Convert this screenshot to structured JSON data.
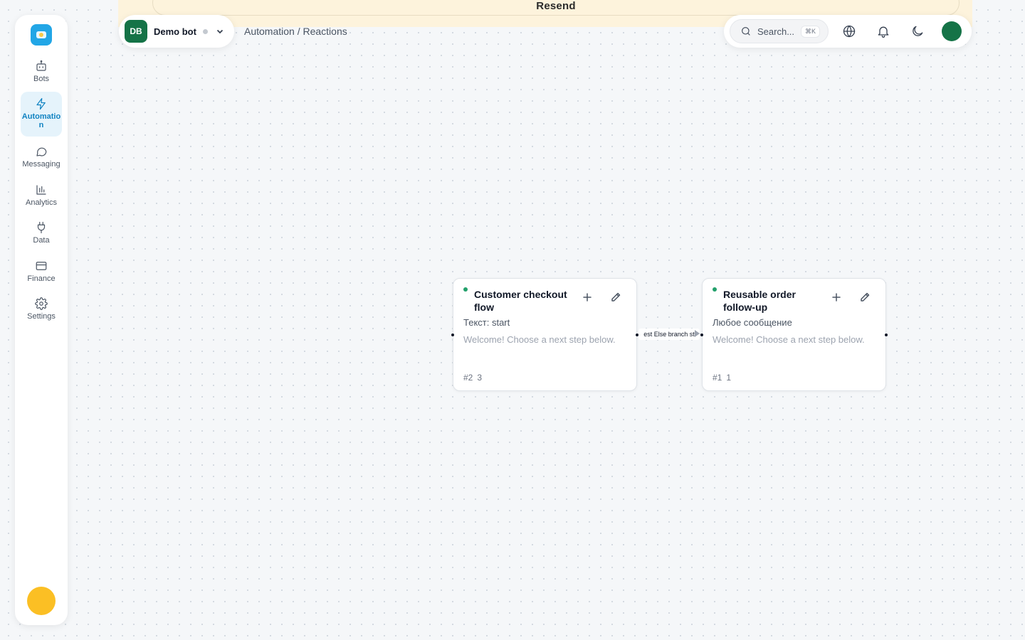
{
  "banner": {
    "text": "Resend"
  },
  "sidebar": {
    "items": [
      {
        "label": "Bots",
        "icon": "bot-icon"
      },
      {
        "label": "Automation",
        "icon": "lightning-icon",
        "active": true
      },
      {
        "label": "Messaging",
        "icon": "chat-bubble-icon"
      },
      {
        "label": "Analytics",
        "icon": "bar-chart-icon"
      },
      {
        "label": "Data",
        "icon": "plug-icon"
      },
      {
        "label": "Finance",
        "icon": "credit-card-icon"
      },
      {
        "label": "Settings",
        "icon": "gear-icon"
      }
    ]
  },
  "bot": {
    "initials": "DB",
    "name": "Demo bot"
  },
  "breadcrumb": "Automation / Reactions",
  "toolbar": {
    "search_placeholder": "Search...",
    "shortcut": "⌘K"
  },
  "nodes": [
    {
      "title": "Customer checkout flow",
      "trigger": "Текст: start",
      "message": "Welcome! Choose a next step below.",
      "id": "#2",
      "count": "3"
    },
    {
      "title": "Reusable order follow-up",
      "trigger": "Любое сообщение",
      "message": "Welcome! Choose a next step below.",
      "id": "#1",
      "count": "1"
    }
  ],
  "edge": {
    "label": "est Else branch st"
  },
  "colors": {
    "accent": "#1183c2",
    "brand": "#157347",
    "banner": "#fdf3dc",
    "status": "#22a06b"
  }
}
